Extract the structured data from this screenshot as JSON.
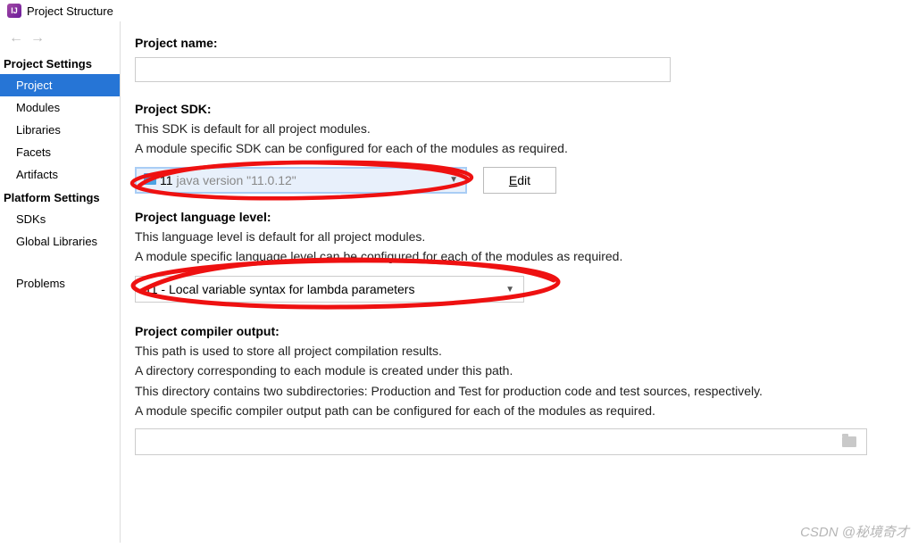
{
  "window": {
    "title": "Project Structure"
  },
  "sidebar": {
    "headings": {
      "project_settings": "Project Settings",
      "platform_settings": "Platform Settings"
    },
    "project_items": [
      "Project",
      "Modules",
      "Libraries",
      "Facets",
      "Artifacts"
    ],
    "platform_items": [
      "SDKs",
      "Global Libraries"
    ],
    "standalone": "Problems",
    "selected": "Project"
  },
  "content": {
    "project_name": {
      "label": "Project name:",
      "value": ""
    },
    "project_sdk": {
      "label": "Project SDK:",
      "desc1": "This SDK is default for all project modules.",
      "desc2": "A module specific SDK can be configured for each of the modules as required.",
      "dropdown": {
        "num": "11",
        "version": "java version \"11.0.12\""
      },
      "edit_label": "Edit",
      "edit_mnemonic": "E"
    },
    "language_level": {
      "label": "Project language level:",
      "desc1": "This language level is default for all project modules.",
      "desc2": "A module specific language level can be configured for each of the modules as required.",
      "selected": "11 - Local variable syntax for lambda parameters"
    },
    "compiler_output": {
      "label": "Project compiler output:",
      "desc1": "This path is used to store all project compilation results.",
      "desc2": "A directory corresponding to each module is created under this path.",
      "desc3": "This directory contains two subdirectories: Production and Test for production code and test sources, respectively.",
      "desc4": "A module specific compiler output path can be configured for each of the modules as required.",
      "value": ""
    }
  },
  "watermark": "CSDN @秘境奇才"
}
